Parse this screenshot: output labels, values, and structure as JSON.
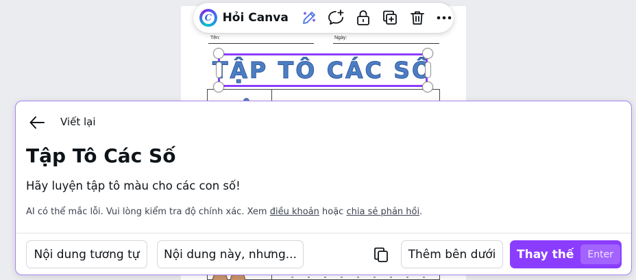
{
  "toolbar": {
    "logo_letter": "C",
    "label": "Hỏi Canva",
    "icons": [
      "magic-pencil-icon",
      "comment-add-icon",
      "lock-icon",
      "duplicate-icon",
      "trash-icon",
      "more-icon"
    ]
  },
  "page": {
    "name_label": "Tên:",
    "date_label": "Ngày:",
    "title": "TẬP TÔ CÁC SỐ"
  },
  "panel": {
    "back_label": "Viết lại",
    "heading": "Tập Tô Các Số",
    "body": "Hãy luyện tập tô màu cho các con số!",
    "disclaimer_prefix": "AI có thể mắc lỗi. Vui lòng kiểm tra độ chính xác. Xem ",
    "terms_link": "điều khoản",
    "disclaimer_mid": " hoặc ",
    "feedback_link": "chia sẻ phản hồi",
    "disclaimer_suffix": ".",
    "similar_button": "Nội dung tương tự",
    "this_but_button": "Nội dung này, nhưng...",
    "add_below_button": "Thêm bên dưới",
    "replace_button": "Thay thế",
    "replace_shortcut": "Enter"
  },
  "colors": {
    "accent": "#8b3dff",
    "title_blue": "#4d7ec4"
  }
}
